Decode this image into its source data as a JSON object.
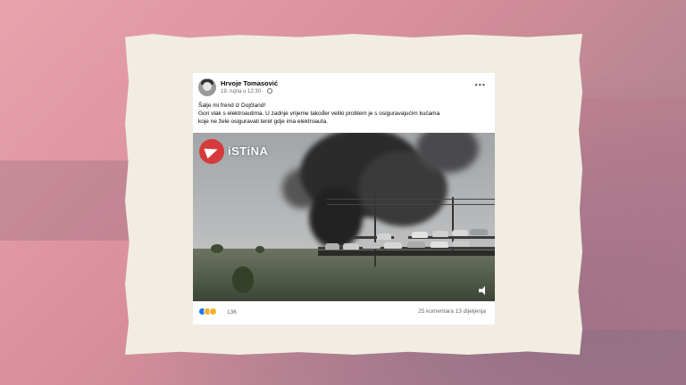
{
  "post": {
    "author": "Hrvoje Tomasović",
    "date": "19. rujna u 12:30",
    "separator": "·",
    "more_label": "•••",
    "text_line1": "Šalje mi frend iz Dojčland!",
    "text_line2": "Gori vlak s elektroautima. U zadnje vrijeme također veliki problem je s osiguravajućim kućama",
    "text_line3": "koje ne žele osiguravati teret gdje ima elektroauta.",
    "video_watermark": "iSTiNA",
    "reaction_count": "136",
    "comments": "25 komentara",
    "shares": "13 dijeljenja"
  },
  "icons": {
    "avatar": "profile-photo",
    "privacy": "globe-icon",
    "watermark_logo": "telegram-icon",
    "mute": "speaker-mute-icon",
    "reactions": [
      "like-icon",
      "haha-icon",
      "wow-icon"
    ]
  },
  "colors": {
    "background": "#e8a3ad",
    "paper": "#f1ede3",
    "card": "#ffffff",
    "meta_text": "#65676b",
    "like_blue": "#1877f2",
    "logo_red": "#d63b3b"
  }
}
